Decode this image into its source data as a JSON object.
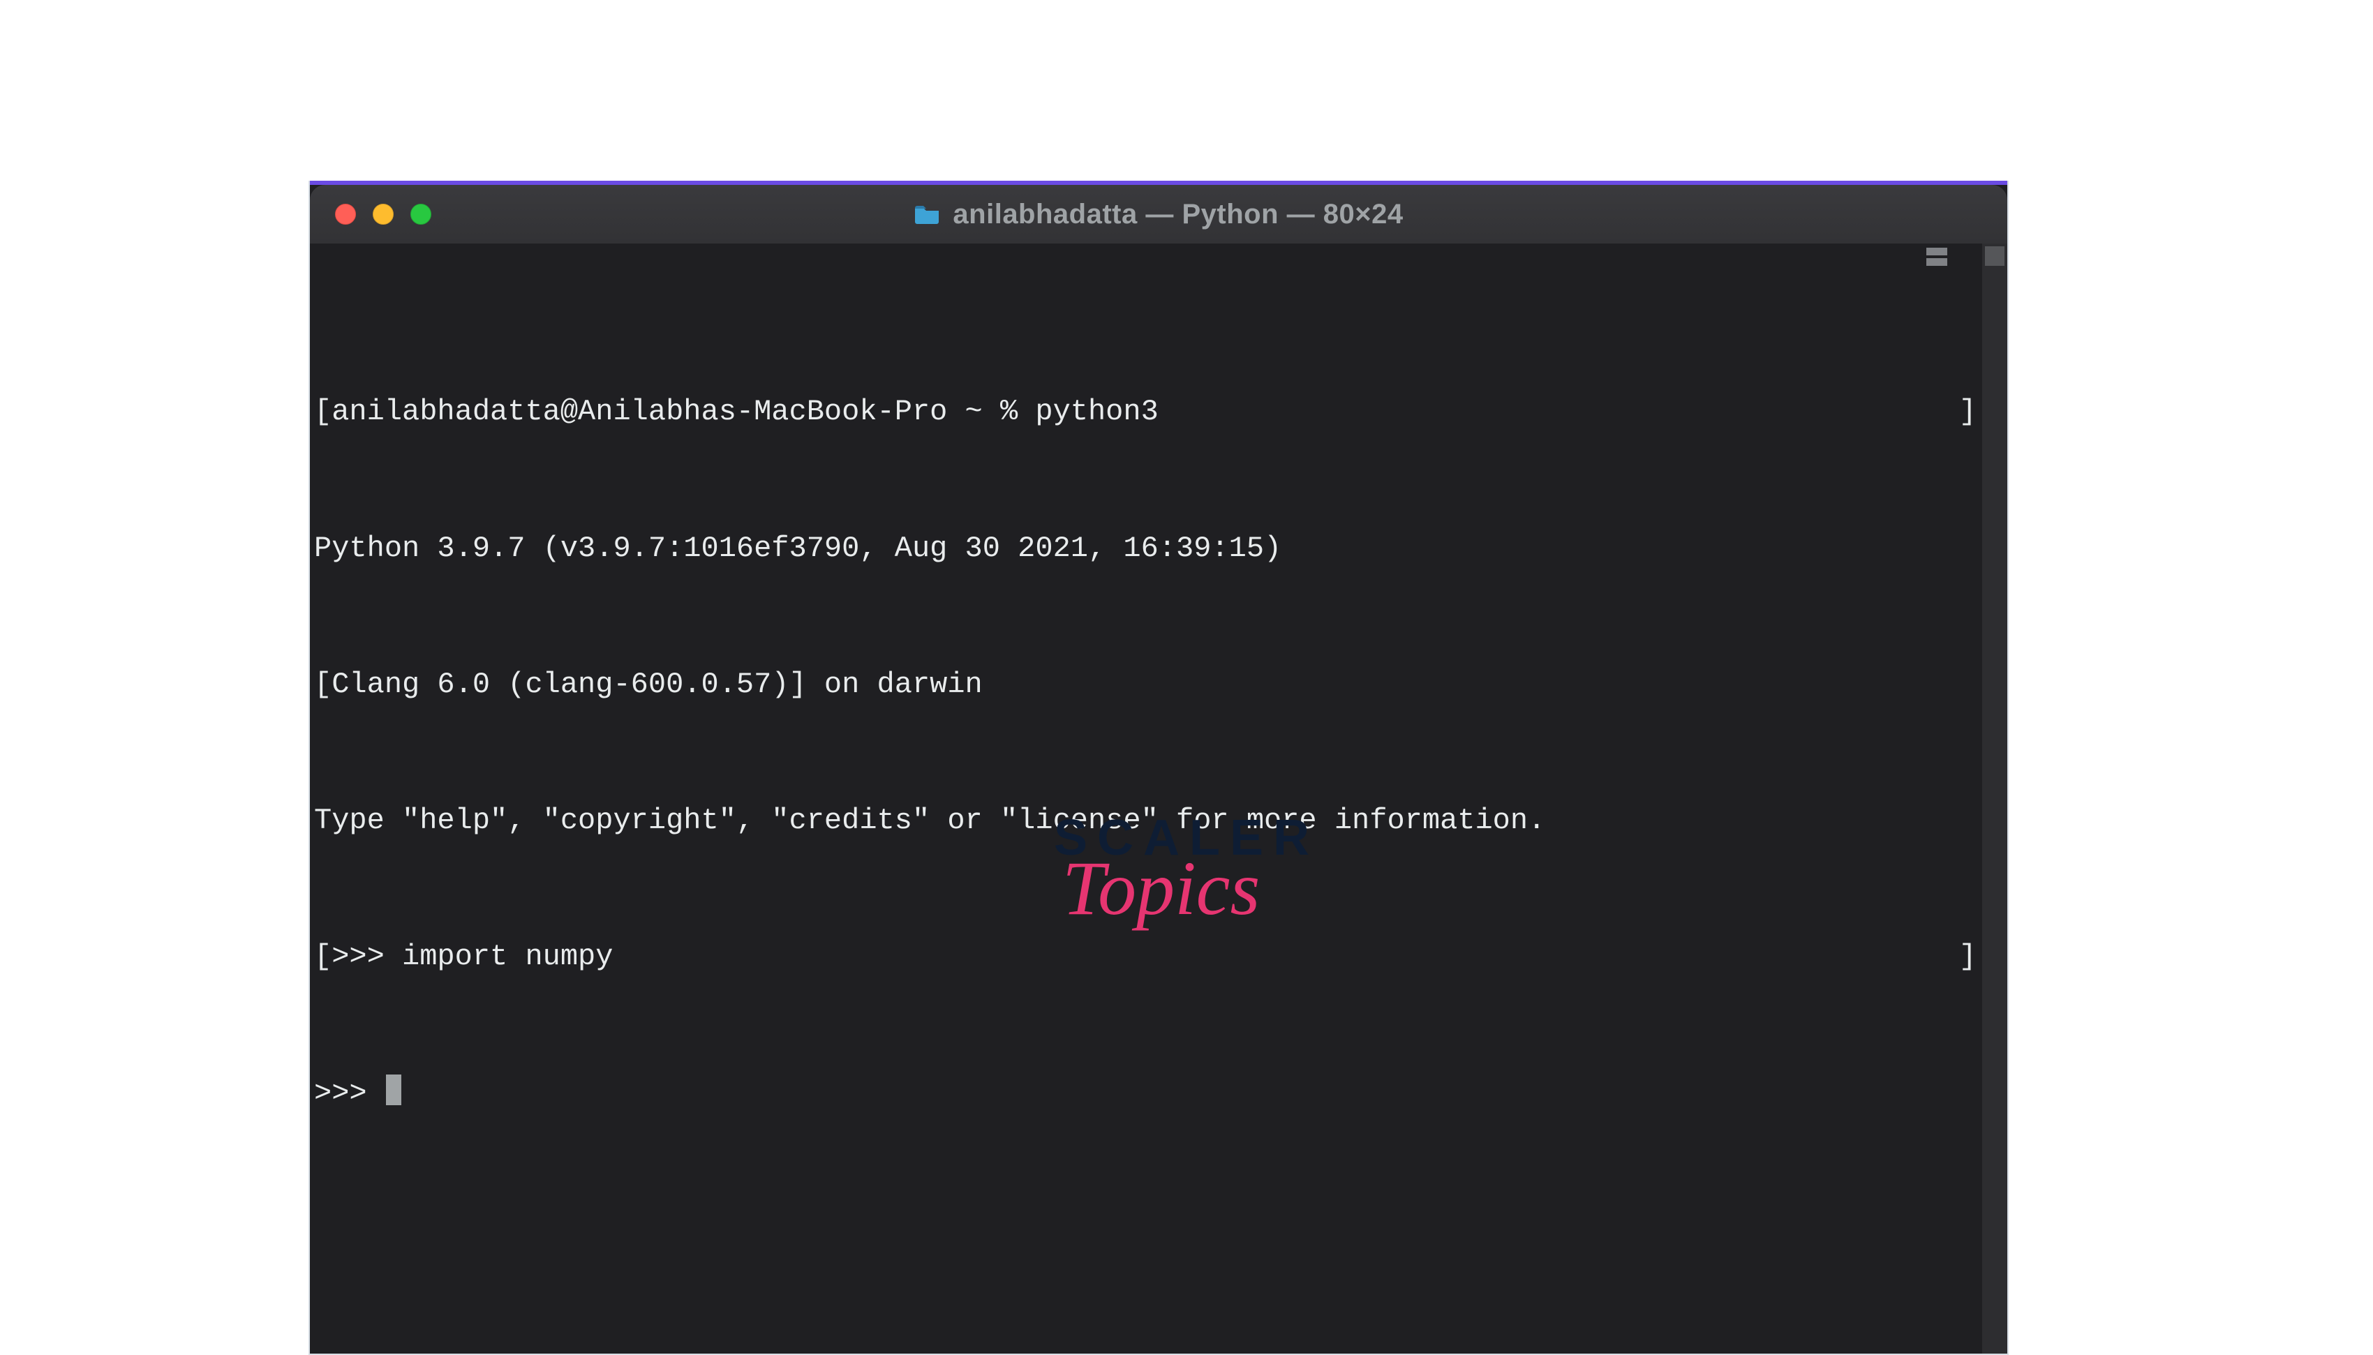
{
  "window": {
    "title": "anilabhadatta — Python — 80×24",
    "folder_icon": "folder-icon"
  },
  "terminal": {
    "lines": {
      "l0_a": "[anilabhadatta@Anilabhas-MacBook-Pro ~ % python3",
      "l0_b": "]",
      "l1": "Python 3.9.7 (v3.9.7:1016ef3790, Aug 30 2021, 16:39:15)",
      "l2": "[Clang 6.0 (clang-600.0.57)] on darwin",
      "l3": "Type \"help\", \"copyright\", \"credits\" or \"license\" for more information.",
      "l4_a": "[>>> import numpy",
      "l4_b": "]",
      "l5": ">>> "
    }
  },
  "brand": {
    "word": "SCALER",
    "script": "Topics"
  }
}
